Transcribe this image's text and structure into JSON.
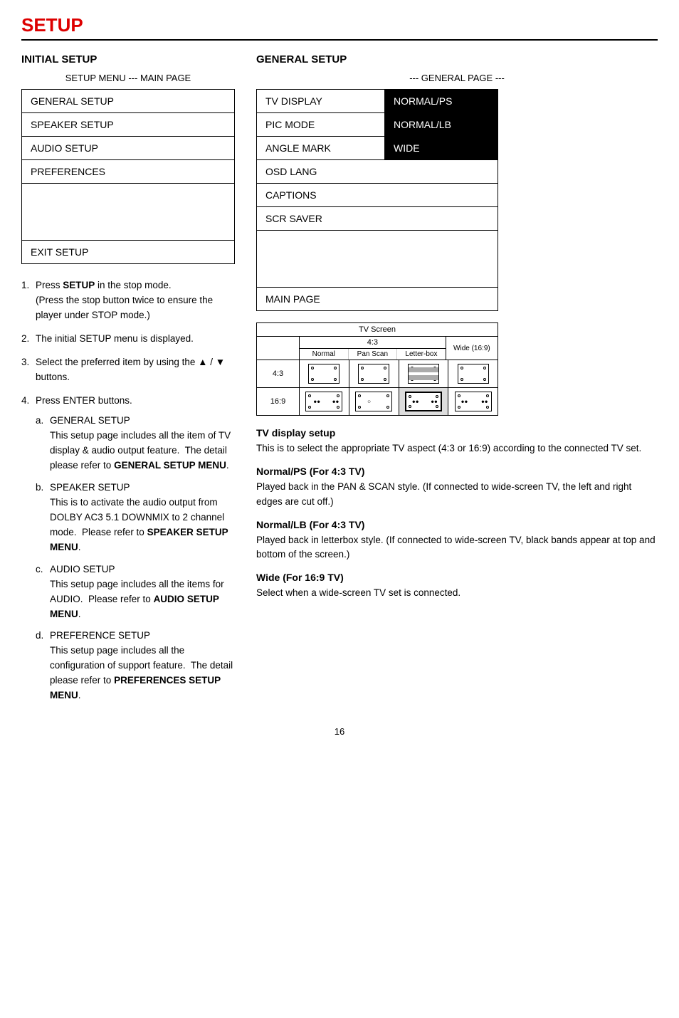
{
  "page": {
    "title": "SETUP",
    "number": "16"
  },
  "initial_setup": {
    "heading": "INITIAL SETUP",
    "sub_heading": "SETUP MENU --- MAIN PAGE",
    "menu_items": [
      "GENERAL SETUP",
      "SPEAKER SETUP",
      "AUDIO SETUP",
      "PREFERENCES"
    ],
    "exit_item": "EXIT SETUP"
  },
  "general_setup": {
    "heading": "GENERAL SETUP",
    "sub_heading": "--- GENERAL PAGE ---",
    "rows": [
      {
        "left": "TV DISPLAY",
        "right": "NORMAL/PS",
        "has_right": true
      },
      {
        "left": "PIC MODE",
        "right": "NORMAL/LB",
        "has_right": true
      },
      {
        "left": "ANGLE MARK",
        "right": "WIDE",
        "has_right": true
      },
      {
        "left": "OSD LANG",
        "right": "",
        "has_right": false
      },
      {
        "left": "CAPTIONS",
        "right": "",
        "has_right": false
      },
      {
        "left": "SCR SAVER",
        "right": "",
        "has_right": false
      }
    ],
    "main_page": "MAIN PAGE"
  },
  "diagram": {
    "title": "TV Screen",
    "header_43": "4:3",
    "header_wide": "Wide (16:9)",
    "sub_headers": [
      "Normal",
      "Pan Scan",
      "Letter-box"
    ],
    "row_labels": [
      "4:3",
      "16:9"
    ]
  },
  "instructions": {
    "steps": [
      {
        "num": "1.",
        "text_before": "Press ",
        "bold": "SETUP",
        "text_after": " in the stop mode.",
        "sub": "(Press the stop button twice to ensure the player under STOP mode.)"
      },
      {
        "num": "2.",
        "text": "The initial SETUP menu is displayed."
      },
      {
        "num": "3.",
        "text": "Select the preferred item by using the ▲ / ▼ buttons."
      },
      {
        "num": "4.",
        "text": "Press ENTER buttons.",
        "sub_items": [
          {
            "letter": "a.",
            "heading": "GENERAL SETUP",
            "body": "This setup page includes all the item of TV display & audio output feature.  The detail please refer to ",
            "bold_ref": "GENERAL SETUP MENU"
          },
          {
            "letter": "b.",
            "heading": "SPEAKER SETUP",
            "body": "This is to activate the audio output from DOLBY AC3 5.1 DOWNMIX to 2 channel mode.  Please refer to ",
            "bold_ref": "SPEAKER SETUP MENU"
          },
          {
            "letter": "c.",
            "heading": "AUDIO SETUP",
            "body": "This setup page includes all the items for AUDIO.  Please refer to ",
            "bold_ref": "AUDIO SETUP MENU"
          },
          {
            "letter": "d.",
            "heading": "PREFERENCE SETUP",
            "body": "This setup page includes all the configuration of support feature.  The detail please refer to ",
            "bold_ref": "PREFERENCES SETUP MENU"
          }
        ]
      }
    ]
  },
  "descriptions": [
    {
      "title": "TV display setup",
      "body": "This is to select the appropriate TV aspect (4:3 or 16:9) according to the connected TV set."
    },
    {
      "title": "Normal/PS (For 4:3 TV)",
      "body": "Played back in the PAN & SCAN style. (If connected to wide-screen TV, the left and right edges are cut off.)"
    },
    {
      "title": "Normal/LB (For 4:3 TV)",
      "body": "Played back in letterbox style. (If connected to wide-screen TV, black bands appear at top and bottom of the screen.)"
    },
    {
      "title": "Wide (For 16:9 TV)",
      "body": "Select when a wide-screen TV set is connected."
    }
  ]
}
